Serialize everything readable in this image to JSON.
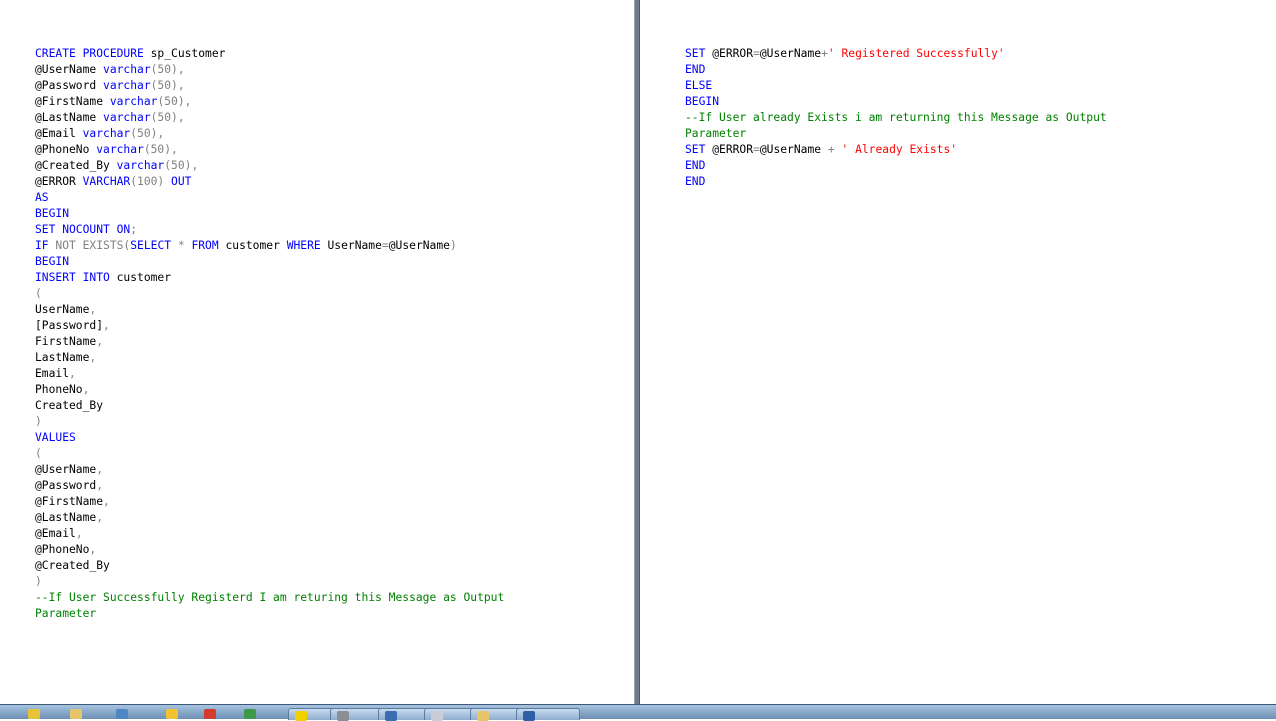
{
  "colors": {
    "keyword": "#0000ff",
    "identifier": "#000000",
    "operator": "#808080",
    "string": "#ff0000",
    "comment": "#008000"
  },
  "left_pane": {
    "lines": [
      [
        {
          "t": "CREATE PROCEDURE ",
          "c": "keyword"
        },
        {
          "t": "sp_Customer",
          "c": "identifier"
        }
      ],
      [
        {
          "t": "@UserName ",
          "c": "identifier"
        },
        {
          "t": "varchar",
          "c": "keyword"
        },
        {
          "t": "(50),",
          "c": "operator"
        }
      ],
      [
        {
          "t": "@Password ",
          "c": "identifier"
        },
        {
          "t": "varchar",
          "c": "keyword"
        },
        {
          "t": "(50),",
          "c": "operator"
        }
      ],
      [
        {
          "t": "@FirstName ",
          "c": "identifier"
        },
        {
          "t": "varchar",
          "c": "keyword"
        },
        {
          "t": "(50),",
          "c": "operator"
        }
      ],
      [
        {
          "t": "@LastName ",
          "c": "identifier"
        },
        {
          "t": "varchar",
          "c": "keyword"
        },
        {
          "t": "(50),",
          "c": "operator"
        }
      ],
      [
        {
          "t": "@Email ",
          "c": "identifier"
        },
        {
          "t": "varchar",
          "c": "keyword"
        },
        {
          "t": "(50),",
          "c": "operator"
        }
      ],
      [
        {
          "t": "@PhoneNo ",
          "c": "identifier"
        },
        {
          "t": "varchar",
          "c": "keyword"
        },
        {
          "t": "(50),",
          "c": "operator"
        }
      ],
      [
        {
          "t": "@Created_By ",
          "c": "identifier"
        },
        {
          "t": "varchar",
          "c": "keyword"
        },
        {
          "t": "(50),",
          "c": "operator"
        }
      ],
      [
        {
          "t": "@ERROR ",
          "c": "identifier"
        },
        {
          "t": "VARCHAR",
          "c": "keyword"
        },
        {
          "t": "(100) ",
          "c": "operator"
        },
        {
          "t": "OUT",
          "c": "keyword"
        }
      ],
      [
        {
          "t": "AS",
          "c": "keyword"
        }
      ],
      [
        {
          "t": "BEGIN",
          "c": "keyword"
        }
      ],
      [
        {
          "t": "SET NOCOUNT ON",
          "c": "keyword"
        },
        {
          "t": ";",
          "c": "operator"
        }
      ],
      [
        {
          "t": "IF ",
          "c": "keyword"
        },
        {
          "t": "NOT EXISTS(",
          "c": "operator"
        },
        {
          "t": "SELECT ",
          "c": "keyword"
        },
        {
          "t": "* ",
          "c": "operator"
        },
        {
          "t": "FROM ",
          "c": "keyword"
        },
        {
          "t": "customer ",
          "c": "identifier"
        },
        {
          "t": "WHERE ",
          "c": "keyword"
        },
        {
          "t": "UserName",
          "c": "identifier"
        },
        {
          "t": "=",
          "c": "operator"
        },
        {
          "t": "@UserName",
          "c": "identifier"
        },
        {
          "t": ")",
          "c": "operator"
        }
      ],
      [
        {
          "t": "BEGIN",
          "c": "keyword"
        }
      ],
      [
        {
          "t": "INSERT INTO ",
          "c": "keyword"
        },
        {
          "t": "customer",
          "c": "identifier"
        }
      ],
      [
        {
          "t": "(",
          "c": "operator"
        }
      ],
      [
        {
          "t": "UserName",
          "c": "identifier"
        },
        {
          "t": ",",
          "c": "operator"
        }
      ],
      [
        {
          "t": "[Password]",
          "c": "identifier"
        },
        {
          "t": ",",
          "c": "operator"
        }
      ],
      [
        {
          "t": "FirstName",
          "c": "identifier"
        },
        {
          "t": ",",
          "c": "operator"
        }
      ],
      [
        {
          "t": "LastName",
          "c": "identifier"
        },
        {
          "t": ",",
          "c": "operator"
        }
      ],
      [
        {
          "t": "Email",
          "c": "identifier"
        },
        {
          "t": ",",
          "c": "operator"
        }
      ],
      [
        {
          "t": "PhoneNo",
          "c": "identifier"
        },
        {
          "t": ",",
          "c": "operator"
        }
      ],
      [
        {
          "t": "Created_By",
          "c": "identifier"
        }
      ],
      [
        {
          "t": ")",
          "c": "operator"
        }
      ],
      [
        {
          "t": "VALUES",
          "c": "keyword"
        }
      ],
      [
        {
          "t": "(",
          "c": "operator"
        }
      ],
      [
        {
          "t": "@UserName",
          "c": "identifier"
        },
        {
          "t": ",",
          "c": "operator"
        }
      ],
      [
        {
          "t": "@Password",
          "c": "identifier"
        },
        {
          "t": ",",
          "c": "operator"
        }
      ],
      [
        {
          "t": "@FirstName",
          "c": "identifier"
        },
        {
          "t": ",",
          "c": "operator"
        }
      ],
      [
        {
          "t": "@LastName",
          "c": "identifier"
        },
        {
          "t": ",",
          "c": "operator"
        }
      ],
      [
        {
          "t": "@Email",
          "c": "identifier"
        },
        {
          "t": ",",
          "c": "operator"
        }
      ],
      [
        {
          "t": "@PhoneNo",
          "c": "identifier"
        },
        {
          "t": ",",
          "c": "operator"
        }
      ],
      [
        {
          "t": "@Created_By",
          "c": "identifier"
        }
      ],
      [
        {
          "t": ")",
          "c": "operator"
        }
      ],
      [
        {
          "t": "--If User Successfully Registerd I am returing this Message as Output",
          "c": "comment"
        }
      ],
      [
        {
          "t": "Parameter",
          "c": "comment"
        }
      ]
    ]
  },
  "right_pane": {
    "lines": [
      [
        {
          "t": "SET ",
          "c": "keyword"
        },
        {
          "t": "@ERROR",
          "c": "identifier"
        },
        {
          "t": "=",
          "c": "operator"
        },
        {
          "t": "@UserName",
          "c": "identifier"
        },
        {
          "t": "+",
          "c": "operator"
        },
        {
          "t": "' Registered Successfully'",
          "c": "string"
        }
      ],
      [
        {
          "t": "END",
          "c": "keyword"
        }
      ],
      [
        {
          "t": "ELSE",
          "c": "keyword"
        }
      ],
      [
        {
          "t": "BEGIN",
          "c": "keyword"
        }
      ],
      [
        {
          "t": "--If User already Exists i am returning this Message as Output",
          "c": "comment"
        }
      ],
      [
        {
          "t": "Parameter",
          "c": "comment"
        }
      ],
      [
        {
          "t": "SET ",
          "c": "keyword"
        },
        {
          "t": "@ERROR",
          "c": "identifier"
        },
        {
          "t": "=",
          "c": "operator"
        },
        {
          "t": "@UserName ",
          "c": "identifier"
        },
        {
          "t": "+ ",
          "c": "operator"
        },
        {
          "t": "' Already Exists'",
          "c": "string"
        }
      ],
      [
        {
          "t": "END",
          "c": "keyword"
        }
      ],
      [
        {
          "t": "END",
          "c": "keyword"
        }
      ]
    ]
  },
  "taskbar": {
    "buttons": [
      {
        "icon": "start-orb-icon",
        "color": "#e8c33a"
      },
      {
        "icon": "folder-icon",
        "color": "#e6c46a"
      },
      {
        "icon": "app-icon",
        "color": "#4f86c6"
      },
      {
        "icon": "star-icon",
        "color": "#f2c230"
      },
      {
        "icon": "chrome-icon",
        "color": "#d23b2e"
      },
      {
        "icon": "excel-icon",
        "color": "#3d9a4a"
      },
      {
        "icon": "warning-icon",
        "color": "#f0d000"
      },
      {
        "icon": "gear-icon",
        "color": "#8a8f96"
      },
      {
        "icon": "explorer-icon",
        "color": "#3b6db0"
      },
      {
        "icon": "document-icon",
        "color": "#c9ced6"
      },
      {
        "icon": "folder-open-icon",
        "color": "#e6c46a"
      },
      {
        "icon": "window-icon",
        "color": "#2f5fa7"
      }
    ]
  }
}
